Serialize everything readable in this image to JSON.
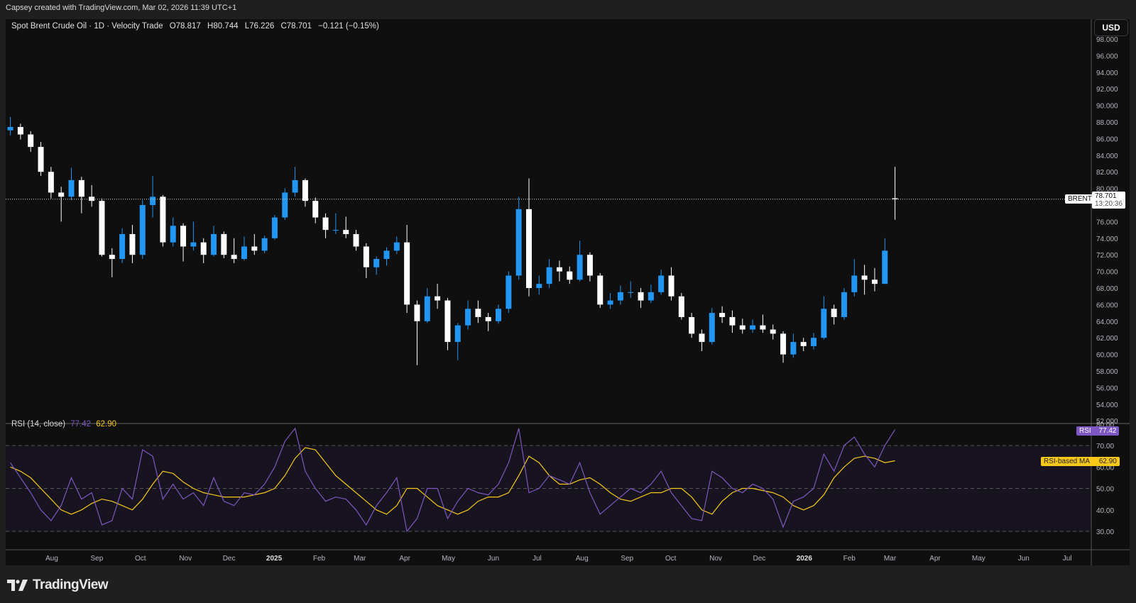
{
  "credit": "Capsey created with TradingView.com, Mar 02, 2026 11:39 UTC+1",
  "legend": {
    "symbol": "Spot Brent Crude Oil · 1D · Velocity Trade",
    "open": "O78.817",
    "high": "H80.744",
    "low": "L76.226",
    "close": "C78.701",
    "change": "−0.121 (−0.15%)"
  },
  "currency_button": "USD",
  "last_price": {
    "symbol": "BRENT",
    "price": "78.701",
    "countdown": "13:20:36",
    "value": 78.701
  },
  "rsi_legend": {
    "name": "RSI (14, close)",
    "rsi": "77.42",
    "ma": "62.90"
  },
  "rsi_tags": {
    "rsi_label": "RSI",
    "rsi_value": "77.42",
    "ma_label": "RSI-based MA",
    "ma_value": "62.90"
  },
  "logo_text": "TradingView",
  "colors": {
    "up": "#2196f3",
    "down": "#ffffff",
    "rsi": "#7e57c2",
    "rsi_ma": "#f7c81a",
    "background": "#0f0f0f"
  },
  "chart_data": [
    {
      "type": "candlestick",
      "title": "Spot Brent Crude Oil · 1D · Velocity Trade",
      "ylabel": "USD",
      "ylim": [
        51,
        99
      ],
      "xlim": [
        "2024-06-28",
        "2026-07-20"
      ],
      "price_ticks": [
        "98.000",
        "96.000",
        "94.000",
        "92.000",
        "90.000",
        "88.000",
        "86.000",
        "84.000",
        "82.000",
        "80.000",
        "78.000",
        "76.000",
        "74.000",
        "72.000",
        "70.000",
        "68.000",
        "66.000",
        "64.000",
        "62.000",
        "60.000",
        "58.000",
        "56.000",
        "54.000",
        "52.000"
      ],
      "time_ticks": [
        {
          "date": "2024-08-01",
          "label": "Aug"
        },
        {
          "date": "2024-09-01",
          "label": "Sep"
        },
        {
          "date": "2024-10-01",
          "label": "Oct"
        },
        {
          "date": "2024-11-01",
          "label": "Nov"
        },
        {
          "date": "2024-12-01",
          "label": "Dec"
        },
        {
          "date": "2025-01-01",
          "label": "2025",
          "bold": true
        },
        {
          "date": "2025-02-01",
          "label": "Feb"
        },
        {
          "date": "2025-03-01",
          "label": "Mar"
        },
        {
          "date": "2025-04-01",
          "label": "Apr"
        },
        {
          "date": "2025-05-01",
          "label": "May"
        },
        {
          "date": "2025-06-01",
          "label": "Jun"
        },
        {
          "date": "2025-07-01",
          "label": "Jul"
        },
        {
          "date": "2025-08-01",
          "label": "Aug"
        },
        {
          "date": "2025-09-01",
          "label": "Sep"
        },
        {
          "date": "2025-10-01",
          "label": "Oct"
        },
        {
          "date": "2025-11-01",
          "label": "Nov"
        },
        {
          "date": "2025-12-01",
          "label": "Dec"
        },
        {
          "date": "2026-01-01",
          "label": "2026",
          "bold": true
        },
        {
          "date": "2026-02-01",
          "label": "Feb"
        },
        {
          "date": "2026-03-01",
          "label": "Mar"
        },
        {
          "date": "2026-04-01",
          "label": "Apr"
        },
        {
          "date": "2026-05-01",
          "label": "May"
        },
        {
          "date": "2026-06-01",
          "label": "Jun"
        },
        {
          "date": "2026-07-01",
          "label": "Jul"
        }
      ],
      "note_columns": [
        "week",
        "open",
        "high",
        "low",
        "close"
      ],
      "ohlc": [
        [
          "2024-07-01",
          87.0,
          88.6,
          86.4,
          87.4
        ],
        [
          "2024-07-08",
          87.4,
          87.8,
          85.9,
          86.5
        ],
        [
          "2024-07-15",
          86.5,
          86.9,
          84.4,
          85.0
        ],
        [
          "2024-07-22",
          85.0,
          85.6,
          81.5,
          82.0
        ],
        [
          "2024-07-29",
          82.0,
          82.6,
          78.8,
          79.5
        ],
        [
          "2024-08-05",
          79.5,
          80.2,
          76.0,
          79.0
        ],
        [
          "2024-08-12",
          79.0,
          82.5,
          78.6,
          81.0
        ],
        [
          "2024-08-19",
          81.0,
          81.4,
          77.0,
          79.0
        ],
        [
          "2024-08-26",
          79.0,
          80.4,
          77.8,
          78.5
        ],
        [
          "2024-09-02",
          78.5,
          78.8,
          71.8,
          72.0
        ],
        [
          "2024-09-09",
          72.0,
          72.8,
          69.3,
          71.5
        ],
        [
          "2024-09-16",
          71.5,
          75.2,
          71.0,
          74.5
        ],
        [
          "2024-09-23",
          74.5,
          75.6,
          71.0,
          72.0
        ],
        [
          "2024-09-30",
          72.0,
          78.6,
          71.5,
          78.0
        ],
        [
          "2024-10-07",
          78.0,
          81.5,
          76.5,
          79.0
        ],
        [
          "2024-10-14",
          79.0,
          79.2,
          73.0,
          73.5
        ],
        [
          "2024-10-21",
          73.5,
          76.5,
          73.0,
          75.5
        ],
        [
          "2024-10-28",
          75.5,
          75.8,
          71.2,
          73.0
        ],
        [
          "2024-11-04",
          73.0,
          76.0,
          72.5,
          73.5
        ],
        [
          "2024-11-11",
          73.5,
          74.0,
          71.0,
          72.0
        ],
        [
          "2024-11-18",
          72.0,
          75.5,
          71.8,
          74.5
        ],
        [
          "2024-11-25",
          74.5,
          74.8,
          71.6,
          72.0
        ],
        [
          "2024-12-02",
          72.0,
          74.0,
          71.0,
          71.5
        ],
        [
          "2024-12-09",
          71.5,
          74.2,
          71.3,
          73.0
        ],
        [
          "2024-12-16",
          73.0,
          74.5,
          72.0,
          72.5
        ],
        [
          "2024-12-23",
          72.5,
          74.3,
          72.2,
          74.0
        ],
        [
          "2024-12-30",
          74.0,
          76.8,
          73.8,
          76.5
        ],
        [
          "2025-01-06",
          76.5,
          80.0,
          76.2,
          79.5
        ],
        [
          "2025-01-13",
          79.5,
          82.6,
          79.0,
          81.0
        ],
        [
          "2025-01-20",
          81.0,
          81.2,
          77.8,
          78.5
        ],
        [
          "2025-01-27",
          78.5,
          78.9,
          75.8,
          76.5
        ],
        [
          "2025-02-03",
          76.5,
          77.0,
          74.0,
          75.0
        ],
        [
          "2025-02-10",
          75.0,
          77.0,
          74.5,
          75.0
        ],
        [
          "2025-02-17",
          75.0,
          76.6,
          74.0,
          74.5
        ],
        [
          "2025-02-24",
          74.5,
          75.0,
          72.5,
          73.0
        ],
        [
          "2025-03-03",
          73.0,
          73.4,
          69.2,
          70.5
        ],
        [
          "2025-03-10",
          70.5,
          71.8,
          69.6,
          71.5
        ],
        [
          "2025-03-17",
          71.5,
          72.9,
          70.7,
          72.5
        ],
        [
          "2025-03-24",
          72.5,
          74.2,
          72.1,
          73.5
        ],
        [
          "2025-03-31",
          73.5,
          75.6,
          65.0,
          66.0
        ],
        [
          "2025-04-07",
          66.0,
          66.5,
          58.7,
          64.0
        ],
        [
          "2025-04-14",
          64.0,
          68.0,
          63.8,
          67.0
        ],
        [
          "2025-04-21",
          67.0,
          68.5,
          65.5,
          66.5
        ],
        [
          "2025-04-28",
          66.5,
          66.8,
          60.5,
          61.5
        ],
        [
          "2025-05-05",
          61.5,
          63.8,
          59.3,
          63.5
        ],
        [
          "2025-05-12",
          63.5,
          66.5,
          63.0,
          65.5
        ],
        [
          "2025-05-19",
          65.5,
          66.5,
          63.8,
          64.5
        ],
        [
          "2025-05-26",
          64.5,
          65.0,
          62.8,
          64.0
        ],
        [
          "2025-06-02",
          64.0,
          66.0,
          63.7,
          65.5
        ],
        [
          "2025-06-09",
          65.5,
          70.0,
          65.0,
          69.5
        ],
        [
          "2025-06-16",
          69.5,
          79.0,
          69.0,
          77.5
        ],
        [
          "2025-06-23",
          77.5,
          81.2,
          67.0,
          68.0
        ],
        [
          "2025-06-30",
          68.0,
          69.5,
          67.2,
          68.5
        ],
        [
          "2025-07-07",
          68.5,
          71.5,
          68.0,
          70.5
        ],
        [
          "2025-07-14",
          70.5,
          71.3,
          68.8,
          70.0
        ],
        [
          "2025-07-21",
          70.0,
          70.6,
          68.5,
          69.0
        ],
        [
          "2025-07-28",
          69.0,
          73.7,
          68.8,
          72.0
        ],
        [
          "2025-08-04",
          72.0,
          72.3,
          68.8,
          69.5
        ],
        [
          "2025-08-11",
          69.5,
          69.8,
          65.6,
          66.0
        ],
        [
          "2025-08-18",
          66.0,
          67.4,
          65.5,
          66.5
        ],
        [
          "2025-08-25",
          66.5,
          68.3,
          66.0,
          67.5
        ],
        [
          "2025-09-01",
          67.5,
          68.8,
          66.8,
          67.5
        ],
        [
          "2025-09-08",
          67.5,
          68.0,
          65.6,
          66.5
        ],
        [
          "2025-09-15",
          66.5,
          68.4,
          66.2,
          67.5
        ],
        [
          "2025-09-22",
          67.5,
          70.2,
          67.2,
          69.5
        ],
        [
          "2025-09-29",
          69.5,
          70.5,
          66.5,
          67.0
        ],
        [
          "2025-10-06",
          67.0,
          67.4,
          64.2,
          64.5
        ],
        [
          "2025-10-13",
          64.5,
          65.0,
          62.0,
          62.5
        ],
        [
          "2025-10-20",
          62.5,
          63.0,
          60.4,
          61.5
        ],
        [
          "2025-10-27",
          61.5,
          65.6,
          61.2,
          65.0
        ],
        [
          "2025-11-03",
          65.0,
          65.8,
          63.8,
          64.5
        ],
        [
          "2025-11-10",
          64.5,
          65.3,
          62.6,
          63.5
        ],
        [
          "2025-11-17",
          63.5,
          64.3,
          62.5,
          63.0
        ],
        [
          "2025-11-24",
          63.0,
          64.2,
          62.6,
          63.5
        ],
        [
          "2025-12-01",
          63.5,
          64.8,
          62.6,
          63.0
        ],
        [
          "2025-12-08",
          63.0,
          63.6,
          61.8,
          62.5
        ],
        [
          "2025-12-15",
          62.5,
          62.8,
          59.0,
          60.0
        ],
        [
          "2025-12-22",
          60.0,
          62.5,
          59.6,
          61.5
        ],
        [
          "2025-12-29",
          61.5,
          62.0,
          60.4,
          61.0
        ],
        [
          "2026-01-05",
          61.0,
          62.6,
          60.6,
          62.0
        ],
        [
          "2026-01-12",
          62.0,
          67.0,
          61.8,
          65.5
        ],
        [
          "2026-01-19",
          65.5,
          66.0,
          63.6,
          64.5
        ],
        [
          "2026-01-26",
          64.5,
          68.0,
          64.2,
          67.5
        ],
        [
          "2026-02-02",
          67.5,
          71.5,
          67.0,
          69.5
        ],
        [
          "2026-02-09",
          69.5,
          70.8,
          67.2,
          69.0
        ],
        [
          "2026-02-16",
          69.0,
          70.4,
          67.6,
          68.5
        ],
        [
          "2026-02-23",
          68.5,
          74.0,
          69.8,
          72.5
        ],
        [
          "2026-03-02",
          78.817,
          82.6,
          76.226,
          78.701
        ]
      ]
    },
    {
      "type": "line",
      "title": "RSI (14, close)",
      "ylim": [
        22,
        82
      ],
      "ticks": [
        "80.00",
        "70.00",
        "60.00",
        "50.00",
        "40.00",
        "30.00"
      ],
      "bands": {
        "upper": 70,
        "middle": 50,
        "lower": 30
      },
      "series": [
        {
          "name": "RSI",
          "values": [
            62,
            55,
            48,
            40,
            35,
            42,
            55,
            45,
            48,
            33,
            35,
            50,
            45,
            68,
            65,
            45,
            52,
            45,
            48,
            42,
            55,
            44,
            42,
            48,
            47,
            52,
            60,
            72,
            78,
            58,
            50,
            44,
            46,
            45,
            40,
            33,
            42,
            48,
            55,
            30,
            36,
            50,
            50,
            36,
            44,
            50,
            48,
            47,
            52,
            62,
            78,
            48,
            50,
            56,
            54,
            52,
            62,
            48,
            38,
            42,
            46,
            50,
            48,
            52,
            58,
            48,
            42,
            36,
            35,
            58,
            55,
            50,
            48,
            52,
            50,
            45,
            32,
            44,
            46,
            50,
            66,
            58,
            70,
            74,
            66,
            60,
            70,
            77.42
          ]
        },
        {
          "name": "RSI-based MA",
          "values": [
            60,
            58,
            55,
            50,
            45,
            40,
            38,
            40,
            43,
            45,
            44,
            42,
            40,
            45,
            52,
            58,
            57,
            53,
            50,
            48,
            47,
            46,
            46,
            46,
            47,
            48,
            50,
            56,
            64,
            69,
            68,
            62,
            56,
            52,
            48,
            44,
            40,
            38,
            42,
            50,
            50,
            46,
            42,
            40,
            38,
            40,
            44,
            46,
            46,
            48,
            56,
            65,
            62,
            56,
            52,
            52,
            54,
            55,
            52,
            48,
            45,
            44,
            46,
            48,
            48,
            50,
            50,
            46,
            40,
            38,
            44,
            48,
            50,
            50,
            49,
            48,
            46,
            42,
            40,
            42,
            47,
            55,
            60,
            64,
            65,
            64,
            62,
            62.9
          ]
        }
      ]
    }
  ]
}
